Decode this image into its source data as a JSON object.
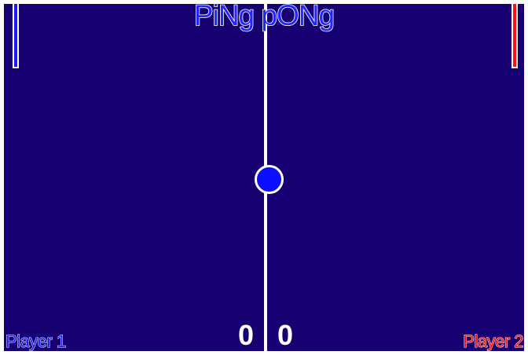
{
  "game": {
    "title": "PiNg pONg"
  },
  "scores": {
    "player1": "0",
    "player2": "0"
  },
  "players": {
    "left_label": "Player 1",
    "right_label": "Player 2"
  },
  "colors": {
    "court": "#170072",
    "player1": "#1a1aff",
    "player2": "#ff1010",
    "ball": "#0a10ff",
    "lines": "#ffffff"
  }
}
